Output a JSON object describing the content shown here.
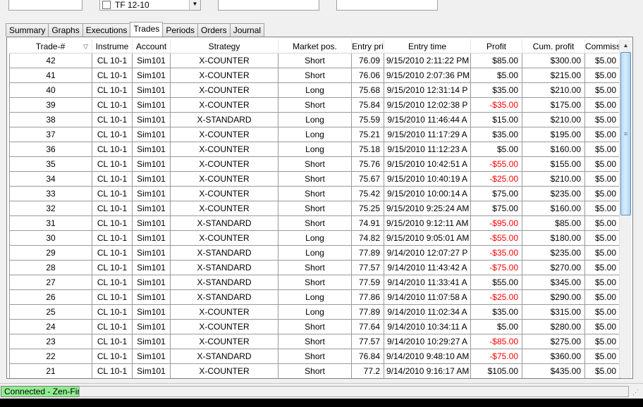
{
  "top": {
    "combo_value": "TF 12-10"
  },
  "tabs": [
    {
      "label": "Summary"
    },
    {
      "label": "Graphs"
    },
    {
      "label": "Executions"
    },
    {
      "label": "Trades"
    },
    {
      "label": "Periods"
    },
    {
      "label": "Orders"
    },
    {
      "label": "Journal"
    }
  ],
  "active_tab": "Trades",
  "columns": [
    "Trade-#",
    "Instrume",
    "Account",
    "Strategy",
    "Market pos.",
    "Entry pri",
    "Entry time",
    "Profit",
    "Cum. profit",
    "Commiss"
  ],
  "rows": [
    [
      "42",
      "CL 10-1",
      "Sim101",
      "X-COUNTER",
      "Short",
      "76.09",
      "9/15/2010 2:11:22 PM",
      "$85.00",
      "$300.00",
      "$5.00"
    ],
    [
      "41",
      "CL 10-1",
      "Sim101",
      "X-COUNTER",
      "Short",
      "76.06",
      "9/15/2010 2:07:36 PM",
      "$5.00",
      "$215.00",
      "$5.00"
    ],
    [
      "40",
      "CL 10-1",
      "Sim101",
      "X-COUNTER",
      "Long",
      "75.68",
      "9/15/2010 12:31:14 P",
      "$35.00",
      "$210.00",
      "$5.00"
    ],
    [
      "39",
      "CL 10-1",
      "Sim101",
      "X-COUNTER",
      "Short",
      "75.84",
      "9/15/2010 12:02:38 P",
      "-$35.00",
      "$175.00",
      "$5.00"
    ],
    [
      "38",
      "CL 10-1",
      "Sim101",
      "X-STANDARD",
      "Long",
      "75.59",
      "9/15/2010 11:46:44 A",
      "$15.00",
      "$210.00",
      "$5.00"
    ],
    [
      "37",
      "CL 10-1",
      "Sim101",
      "X-COUNTER",
      "Long",
      "75.21",
      "9/15/2010 11:17:29 A",
      "$35.00",
      "$195.00",
      "$5.00"
    ],
    [
      "36",
      "CL 10-1",
      "Sim101",
      "X-COUNTER",
      "Long",
      "75.18",
      "9/15/2010 11:12:23 A",
      "$5.00",
      "$160.00",
      "$5.00"
    ],
    [
      "35",
      "CL 10-1",
      "Sim101",
      "X-COUNTER",
      "Short",
      "75.76",
      "9/15/2010 10:42:51 A",
      "-$55.00",
      "$155.00",
      "$5.00"
    ],
    [
      "34",
      "CL 10-1",
      "Sim101",
      "X-COUNTER",
      "Short",
      "75.67",
      "9/15/2010 10:40:19 A",
      "-$25.00",
      "$210.00",
      "$5.00"
    ],
    [
      "33",
      "CL 10-1",
      "Sim101",
      "X-COUNTER",
      "Short",
      "75.42",
      "9/15/2010 10:00:14 A",
      "$75.00",
      "$235.00",
      "$5.00"
    ],
    [
      "32",
      "CL 10-1",
      "Sim101",
      "X-COUNTER",
      "Short",
      "75.25",
      "9/15/2010 9:25:24 AM",
      "$75.00",
      "$160.00",
      "$5.00"
    ],
    [
      "31",
      "CL 10-1",
      "Sim101",
      "X-STANDARD",
      "Short",
      "74.91",
      "9/15/2010 9:12:11 AM",
      "-$95.00",
      "$85.00",
      "$5.00"
    ],
    [
      "30",
      "CL 10-1",
      "Sim101",
      "X-COUNTER",
      "Long",
      "74.82",
      "9/15/2010 9:05:01 AM",
      "-$55.00",
      "$180.00",
      "$5.00"
    ],
    [
      "29",
      "CL 10-1",
      "Sim101",
      "X-STANDARD",
      "Long",
      "77.89",
      "9/14/2010 12:07:27 P",
      "-$35.00",
      "$235.00",
      "$5.00"
    ],
    [
      "28",
      "CL 10-1",
      "Sim101",
      "X-STANDARD",
      "Short",
      "77.57",
      "9/14/2010 11:43:42 A",
      "-$75.00",
      "$270.00",
      "$5.00"
    ],
    [
      "27",
      "CL 10-1",
      "Sim101",
      "X-STANDARD",
      "Short",
      "77.59",
      "9/14/2010 11:33:41 A",
      "$55.00",
      "$345.00",
      "$5.00"
    ],
    [
      "26",
      "CL 10-1",
      "Sim101",
      "X-STANDARD",
      "Long",
      "77.86",
      "9/14/2010 11:07:58 A",
      "-$25.00",
      "$290.00",
      "$5.00"
    ],
    [
      "25",
      "CL 10-1",
      "Sim101",
      "X-COUNTER",
      "Long",
      "77.89",
      "9/14/2010 11:02:34 A",
      "$35.00",
      "$315.00",
      "$5.00"
    ],
    [
      "24",
      "CL 10-1",
      "Sim101",
      "X-COUNTER",
      "Short",
      "77.64",
      "9/14/2010 10:34:11 A",
      "$5.00",
      "$280.00",
      "$5.00"
    ],
    [
      "23",
      "CL 10-1",
      "Sim101",
      "X-COUNTER",
      "Short",
      "77.57",
      "9/14/2010 10:29:27 A",
      "-$85.00",
      "$275.00",
      "$5.00"
    ],
    [
      "22",
      "CL 10-1",
      "Sim101",
      "X-STANDARD",
      "Short",
      "76.84",
      "9/14/2010 9:48:10 AM",
      "-$75.00",
      "$360.00",
      "$5.00"
    ],
    [
      "21",
      "CL 10-1",
      "Sim101",
      "X-COUNTER",
      "Short",
      "77.2",
      "9/14/2010 9:16:17 AM",
      "$105.00",
      "$435.00",
      "$5.00"
    ]
  ],
  "colors": {
    "negative_profit": "#ff0000",
    "connection_ok": "#90ee90"
  },
  "status": {
    "connection": "Connected - Zen-Fire"
  },
  "icons": {
    "sort": "sort-descending-icon",
    "combo_arrow": "dropdown-arrow-icon",
    "scroll_up": "scroll-up-arrow-icon",
    "resize": "resize-grip-icon"
  }
}
